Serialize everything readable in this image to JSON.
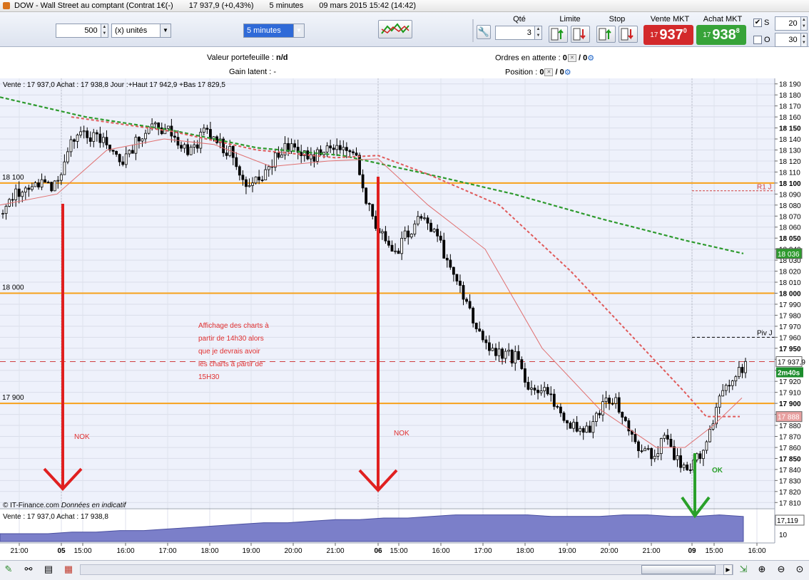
{
  "titlebar": {
    "instrument": "DOW - Wall Street au comptant (Contrat 1€(-)",
    "quote": "17 937,9 (+0,43%)",
    "interval": "5 minutes",
    "datetime": "09 mars 2015 15:42 (14:42)"
  },
  "toolbar": {
    "quantity_value": "500",
    "units_label": "(x) unités",
    "timeframe": "5 minutes",
    "qty_header": "Qté",
    "qty_value": "3",
    "limit_header": "Limite",
    "stop_header": "Stop",
    "sell_header": "Vente MKT",
    "buy_header": "Achat MKT",
    "sell_small": "17",
    "sell_big": "937",
    "sell_sup": "0",
    "buy_small": "17",
    "buy_big": "938",
    "buy_sup": "8",
    "s_label": "S",
    "s_value": "20",
    "o_label": "O",
    "o_value": "30",
    "s_checked": "✔",
    "sell_color": "#d3292b",
    "buy_color": "#37a339"
  },
  "info": {
    "portfolio_label": "Valeur portefeuille :",
    "portfolio_value": "n/d",
    "latent_label": "Gain latent :",
    "latent_value": "-",
    "pending_label": "Ordres en attente :",
    "pending_value": "0",
    "pending_value2": "/ 0",
    "position_label": "Position :",
    "position_value": "0",
    "position_value2": "/ 0"
  },
  "chart": {
    "header": "Vente : 17 937,0 Achat : 17 938,8 Jour :+Haut 17 942,9 +Bas 17 829,5",
    "copyright": "© IT-Finance.com",
    "disclaimer": "Données en indicatif",
    "volume_header": "Vente : 17 937,0 Achat : 17 938,8",
    "price_axis": [
      "18 190",
      "18 180",
      "18 170",
      "18 160",
      "18 150",
      "18 140",
      "18 130",
      "18 120",
      "18 110",
      "18 100",
      "18 090",
      "18 080",
      "18 070",
      "18 060",
      "18 050",
      "18 040",
      "18 030",
      "18 020",
      "18 010",
      "18 000",
      "17 990",
      "17 980",
      "17 970",
      "17 960",
      "17 950",
      "17 940",
      "17 930",
      "17 920",
      "17 910",
      "17 900",
      "17 890",
      "17 880",
      "17 870",
      "17 860",
      "17 850",
      "17 840",
      "17 830",
      "17 820",
      "17 810"
    ],
    "bold_ticks": [
      "18 150",
      "18 100",
      "18 050",
      "18 000",
      "17 950",
      "17 900",
      "17 850"
    ],
    "level_labels": [
      "18 100",
      "18 000",
      "17 900"
    ],
    "tag_piv": "Piv J",
    "tag_r1": "R1 J",
    "badge_ma_long": "18 036",
    "badge_price": "17 937,9",
    "badge_timer": "2m40s",
    "badge_ma_short": "17 888",
    "volume_badge": "17,119",
    "volume_tick": "10",
    "time_axis": [
      "21:00",
      "05",
      "15:00",
      "16:00",
      "17:00",
      "18:00",
      "19:00",
      "20:00",
      "21:00",
      "06",
      "15:00",
      "16:00",
      "17:00",
      "18:00",
      "19:00",
      "20:00",
      "21:00",
      "09",
      "15:00",
      "16:00"
    ],
    "time_bold": [
      "05",
      "06",
      "09"
    ],
    "annotation": [
      "Affichage des charts à",
      "partir de 14h30 alors",
      "que je devrais avoir",
      "les charts à partir de",
      "15H30"
    ],
    "nok_label": "NOK",
    "ok_label": "OK",
    "colors": {
      "level_line": "#f7a11b",
      "ma_long": "#2d9a2d",
      "ma_mid": "#e05a5a",
      "annotation": "#e03030",
      "arrow_red": "#e02020",
      "arrow_green": "#2aa02a",
      "volume_fill": "#7b7fc9"
    }
  },
  "chart_data": {
    "type": "candlestick",
    "title": "DOW - Wall Street au comptant (Contrat 1€(-)",
    "interval": "5 minutes",
    "ylim": [
      17805,
      18195
    ],
    "levels": [
      18100,
      18000,
      17900
    ],
    "pivot": 17960,
    "r1": 18093,
    "last": 17937.9,
    "ma_long_last": 18036,
    "ma_short_last": 17888,
    "day_high": 17942.9,
    "day_low": 17829.5,
    "price_path": [
      [
        18065,
        18080
      ],
      [
        18085,
        18095
      ],
      [
        18095,
        18100
      ],
      [
        18095,
        18102
      ],
      [
        18098,
        18100
      ],
      [
        18150,
        18135
      ],
      [
        18140,
        18145
      ],
      [
        18145,
        18140
      ],
      [
        18125,
        18130
      ],
      [
        18110,
        18125
      ],
      [
        18135,
        18150
      ],
      [
        18155,
        18150
      ],
      [
        18155,
        18145
      ],
      [
        18140,
        18130
      ],
      [
        18125,
        18135
      ],
      [
        18145,
        18150
      ],
      [
        18140,
        18135
      ],
      [
        18130,
        18120
      ],
      [
        18110,
        18095
      ],
      [
        18095,
        18110
      ],
      [
        18115,
        18125
      ],
      [
        18130,
        18135
      ],
      [
        18130,
        18125
      ],
      [
        18120,
        18125
      ],
      [
        18130,
        18135
      ],
      [
        18135,
        18130
      ],
      [
        18150,
        18115
      ],
      [
        18090,
        18070
      ],
      [
        18060,
        18050
      ],
      [
        18040,
        18030
      ],
      [
        18050,
        18060
      ],
      [
        18070,
        18065
      ],
      [
        18055,
        18050
      ],
      [
        18040,
        18020
      ],
      [
        18000,
        17995
      ],
      [
        17980,
        17960
      ],
      [
        17955,
        17950
      ],
      [
        17940,
        17945
      ],
      [
        17950,
        17935
      ],
      [
        17920,
        17900
      ],
      [
        17905,
        17920
      ],
      [
        17905,
        17890
      ],
      [
        17880,
        17880
      ],
      [
        17875,
        17870
      ],
      [
        17880,
        17895
      ],
      [
        17905,
        17910
      ],
      [
        17895,
        17880
      ],
      [
        17865,
        17850
      ],
      [
        17850,
        17855
      ],
      [
        17865,
        17870
      ],
      [
        17855,
        17840
      ],
      [
        17850,
        17835
      ],
      [
        17845,
        17870
      ],
      [
        17900,
        17910
      ],
      [
        17920,
        17930
      ],
      [
        17935,
        17937
      ]
    ],
    "volume_path": [
      5,
      5,
      5,
      6,
      6,
      7,
      7,
      8,
      9,
      10,
      11,
      12,
      12,
      13,
      14,
      14,
      15,
      15,
      16,
      17,
      17,
      17,
      17,
      16,
      16,
      16,
      17,
      17,
      16,
      16,
      17,
      16
    ]
  }
}
